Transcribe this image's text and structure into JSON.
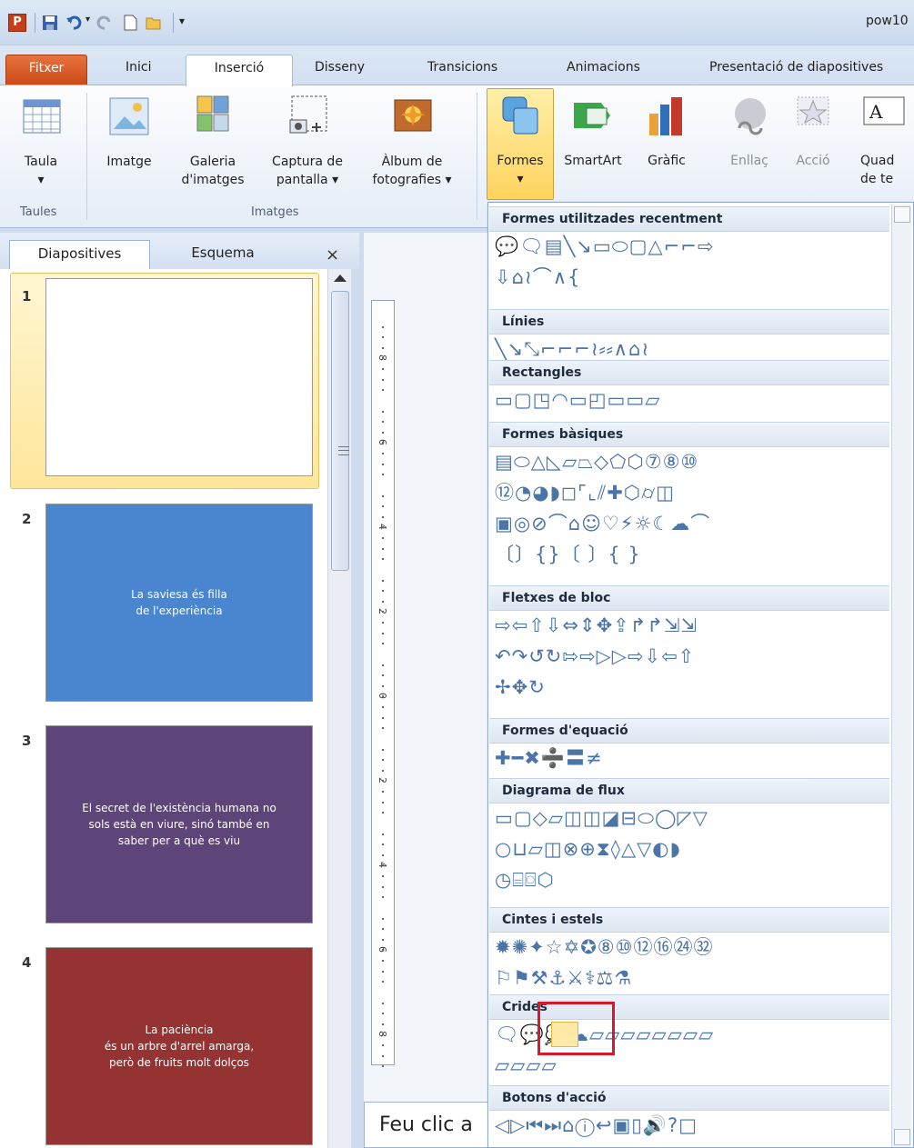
{
  "app": {
    "window_title": "pow10",
    "app_icon_letter": "P"
  },
  "quick_access": {
    "icons": [
      "ppt-icon",
      "save-icon",
      "undo-icon",
      "redo-icon",
      "new-icon",
      "open-icon",
      "customize-icon"
    ]
  },
  "tabs": [
    "Fitxer",
    "Inici",
    "Inserció",
    "Disseny",
    "Transicions",
    "Animacions",
    "Presentació de diapositives"
  ],
  "active_tab": "Inserció",
  "ribbon": {
    "buttons": [
      {
        "label": "Taula",
        "label2": "▾",
        "icon": "table-icon"
      },
      {
        "label": "Imatge",
        "label2": "",
        "icon": "picture-icon"
      },
      {
        "label": "Galeria",
        "label2": "d'imatges",
        "icon": "clipart-icon"
      },
      {
        "label": "Captura de",
        "label2": "pantalla ▾",
        "icon": "screenshot-icon"
      },
      {
        "label": "Àlbum de",
        "label2": "fotografies ▾",
        "icon": "photo-album-icon"
      },
      {
        "label": "Formes",
        "label2": "▾",
        "icon": "shapes-icon"
      },
      {
        "label": "SmartArt",
        "label2": "",
        "icon": "smartart-icon"
      },
      {
        "label": "Gràfic",
        "label2": "",
        "icon": "chart-icon"
      },
      {
        "label": "Enllaç",
        "label2": "",
        "icon": "hyperlink-icon"
      },
      {
        "label": "Acció",
        "label2": "",
        "icon": "action-icon"
      },
      {
        "label": "Quad",
        "label2": "de te",
        "icon": "textbox-icon"
      }
    ],
    "groups": [
      "Taules",
      "Imatges"
    ]
  },
  "side_panel": {
    "tabs": [
      "Diapositives",
      "Esquema"
    ],
    "close": "×"
  },
  "slides": [
    {
      "num": "1",
      "text": "",
      "color": "#ffffff"
    },
    {
      "num": "2",
      "text": "La saviesa és filla\nde l'experiència",
      "color": "#4a86d0"
    },
    {
      "num": "3",
      "text": "El secret de l'existència humana no\nsols està en viure, sinó també en\nsaber per a què es viu",
      "color": "#5d457a"
    },
    {
      "num": "4",
      "text": "La paciència\nés un arbre d'arrel amarga,\nperò de fruits molt dolços",
      "color": "#943332"
    }
  ],
  "ruler": {
    "labels": [
      "8",
      "6",
      "4",
      "2",
      "0",
      "2",
      "4",
      "6",
      "8"
    ]
  },
  "notes": {
    "placeholder": "Feu clic a"
  },
  "shapes_menu": {
    "categories": [
      {
        "title": "Formes utilitzades recentment",
        "rows": [
          "💬🗨▤╲↘▭⬭▢△⌐⌐⇨",
          "⇩⌂≀⌒∧{"
        ]
      },
      {
        "title": "Línies",
        "rows": [
          "╲↘⤡⌐⌐⌐≀⸗⸗∧⌂≀"
        ]
      },
      {
        "title": "Rectangles",
        "rows": [
          "▭▢◳◠▭◰▭▭▱"
        ]
      },
      {
        "title": "Formes bàsiques",
        "rows": [
          "▤⬭△◺▱⏢◇⬠⬡⑦⑧⑩",
          "⑫◔◕◗◻⌜⌞⫽✚⬡⌭◫",
          "▣◎⊘⌒⌂☺♡⚡☼☾☁⌒",
          "〔〕{}〔 〕{ }"
        ]
      },
      {
        "title": "Fletxes de bloc",
        "rows": [
          "⇨⇦⇧⇩⇔⇕✥⇪↱↱⇲⇲",
          "↶↷↺↻⇰⇨▷▷⇨⇩⇦⇧",
          "✢✥↻"
        ]
      },
      {
        "title": "Formes d'equació",
        "rows": [
          "✚━✖➗〓≠"
        ]
      },
      {
        "title": "Diagrama de flux",
        "rows": [
          "▭▢◇▱◫◫◪⊟⬭◯◸▽",
          "○⊔▱◫⊗⊕⧗◊△▽◐◗",
          "◷⌸⌼⬡"
        ]
      },
      {
        "title": "Cintes i estels",
        "rows": [
          "✹✺✦☆✡✪⑧⑩⑫⑯㉔㉜",
          "⚐⚑⚒⚓⚔⚕⚖⚗"
        ]
      },
      {
        "title": "Crides",
        "rows": [
          "🗨💬💭☁▱▱▱▱▱▱▱▱",
          "▱▱▱▱"
        ]
      },
      {
        "title": "Botons d'acció",
        "rows": [
          "◁▷⏮⏭⌂ⓘ↩▣▯🔊?□"
        ]
      }
    ]
  },
  "colors": {
    "accent": "#c43e1c",
    "selected": "#ffd35e",
    "highlight_box": "#d8192a"
  }
}
